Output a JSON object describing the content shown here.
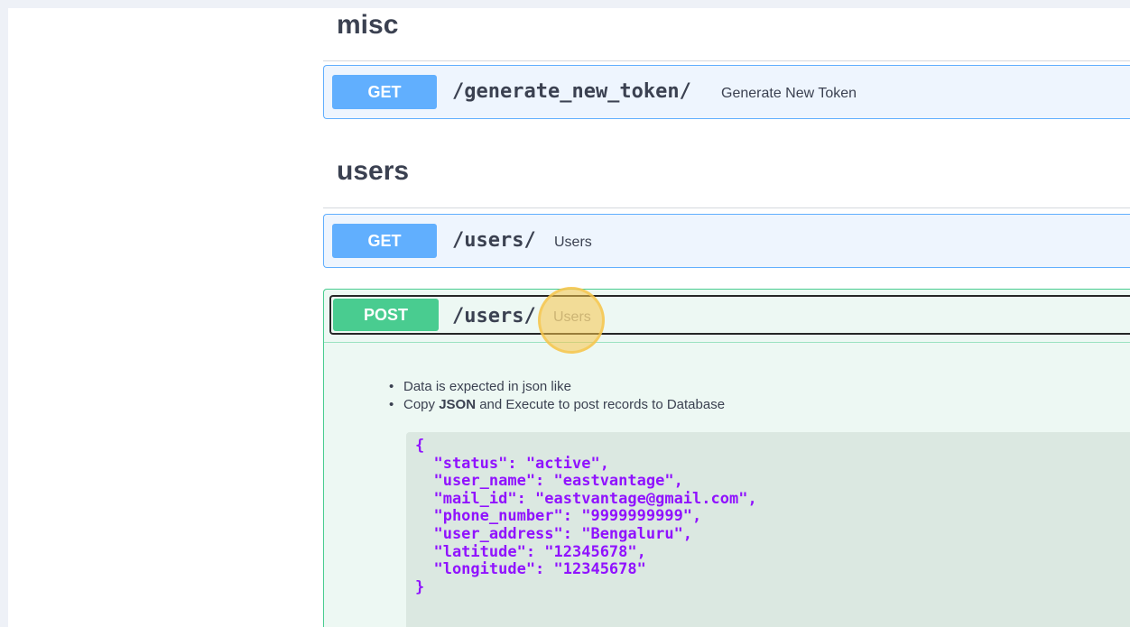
{
  "sections": {
    "misc": {
      "title": "misc",
      "endpoints": [
        {
          "method": "GET",
          "path": "/generate_new_token/",
          "summary": "Generate New Token"
        }
      ]
    },
    "users": {
      "title": "users",
      "endpoints": [
        {
          "method": "GET",
          "path": "/users/",
          "summary": "Users"
        },
        {
          "method": "POST",
          "path": "/users/",
          "summary": "Users",
          "description": {
            "line1": "Data is expected in json like",
            "line2_prefix": "Copy ",
            "line2_bold": "JSON",
            "line2_suffix": " and Execute to post records to Database"
          },
          "code": {
            "open": "{",
            "lines": [
              "  \"status\": \"active\",",
              "  \"user_name\": \"eastvantage\",",
              "  \"mail_id\": \"eastvantage@gmail.com\",",
              "  \"phone_number\": \"9999999999\",",
              "  \"user_address\": \"Bengaluru\",",
              "  \"latitude\": \"12345678\",",
              "  \"longitude\": \"12345678\""
            ],
            "close": "}"
          }
        }
      ]
    }
  },
  "colors": {
    "get": "#61affe",
    "post": "#49cc90",
    "code_text": "#9012fe",
    "click_highlight": "#f6c44b"
  }
}
